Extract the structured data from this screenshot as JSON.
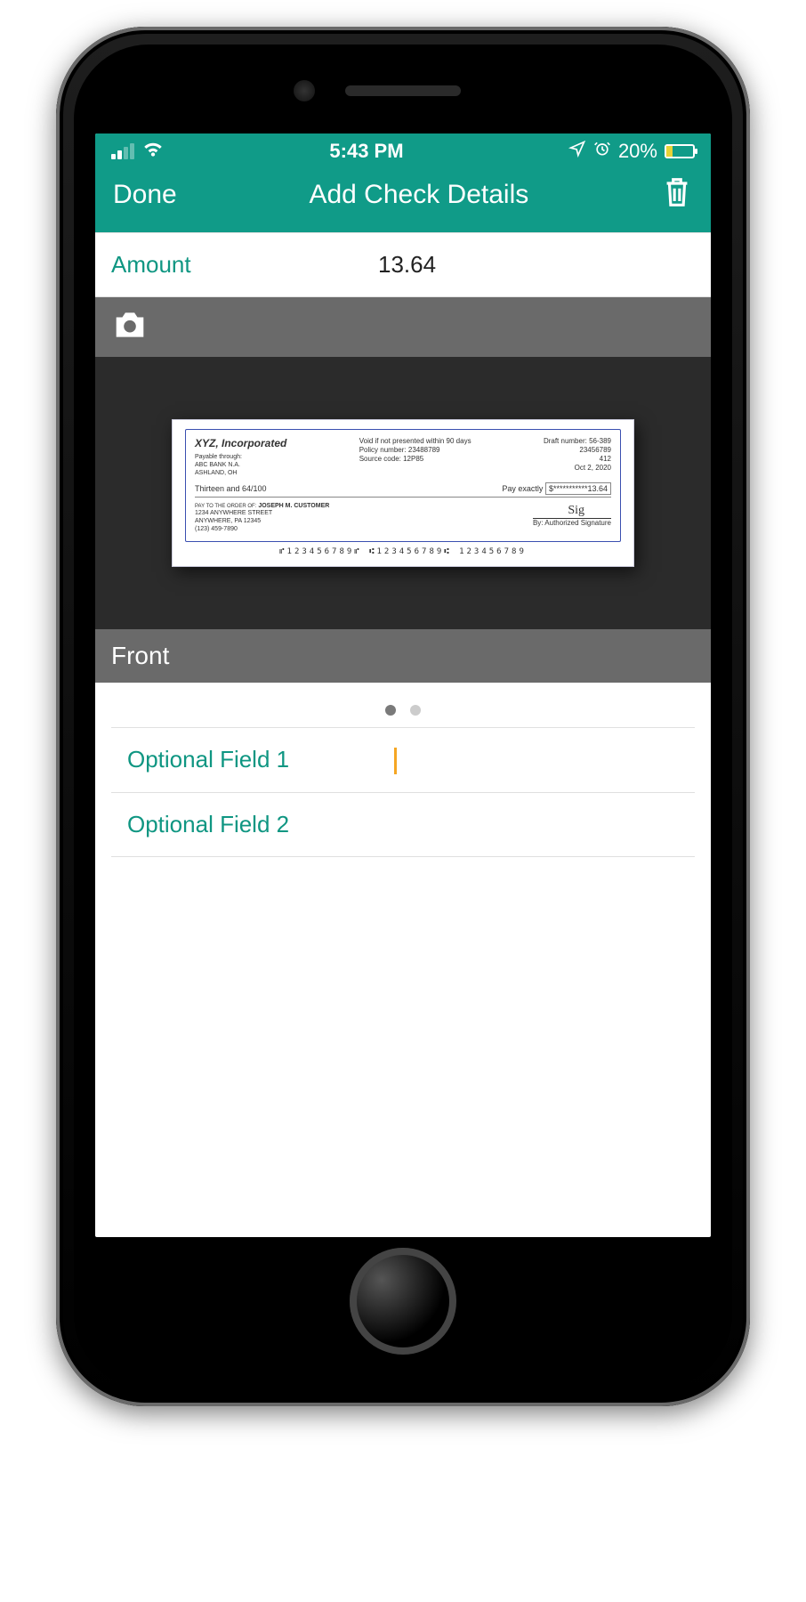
{
  "statusbar": {
    "time": "5:43 PM",
    "battery_pct": "20%"
  },
  "nav": {
    "done": "Done",
    "title": "Add Check Details"
  },
  "amount": {
    "label": "Amount",
    "value": "13.64"
  },
  "image_side_label": "Front",
  "page_dots": {
    "active": 0,
    "count": 2
  },
  "fields": [
    {
      "label": "Optional Field 1",
      "value": ""
    },
    {
      "label": "Optional Field 2",
      "value": ""
    }
  ],
  "check": {
    "company": "XYZ, Incorporated",
    "payable_through": "Payable through:",
    "bank": "ABC BANK N.A.",
    "bank_city": "ASHLAND, OH",
    "void_text": "Void if not presented within 90 days",
    "policy_label": "Policy number:",
    "policy_number": "23488789",
    "source_label": "Source code:",
    "source_code": "12P85",
    "draft_label": "Draft number:",
    "draft_num1": "56-389",
    "draft_num2": "23456789",
    "draft_num3": "412",
    "date": "Oct 2, 2020",
    "written_amount": "Thirteen and 64/100",
    "pay_exactly": "Pay exactly",
    "pay_amount": "$***********13.64",
    "pay_to_label": "PAY TO THE ORDER OF:",
    "pay_to_name": "JOSEPH M. CUSTOMER",
    "addr1": "1234 ANYWHERE STREET",
    "addr2": "ANYWHERE, PA 12345",
    "phone": "(123) 459-7890",
    "by": "By:",
    "auth_sig": "Authorized Signature",
    "micr": "⑈123456789⑈ ⑆123456789⑆ 123456789"
  }
}
